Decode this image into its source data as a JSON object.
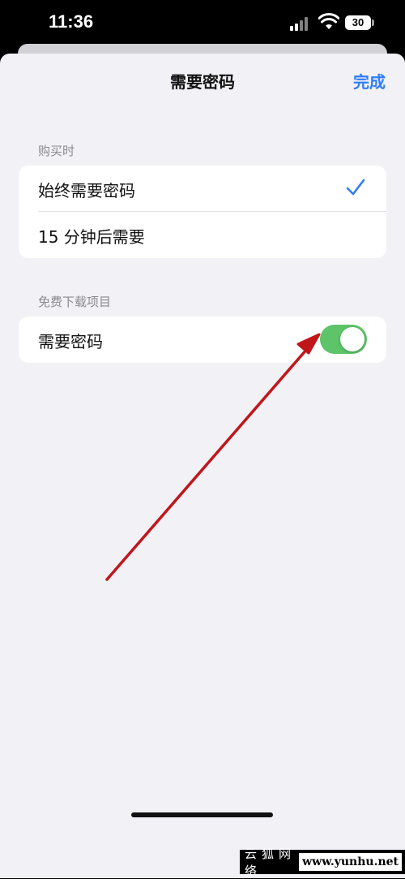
{
  "status_bar": {
    "time": "11:36",
    "battery": "30"
  },
  "nav": {
    "title": "需要密码",
    "done_label": "完成"
  },
  "sections": {
    "purchase": {
      "header": "购买时",
      "options": [
        {
          "label": "始终需要密码",
          "selected": true
        },
        {
          "label": "15 分钟后需要",
          "selected": false
        }
      ]
    },
    "free_downloads": {
      "header": "免费下载项目",
      "row_label": "需要密码",
      "toggle_on": true
    }
  },
  "watermark": {
    "name": "云狐网络",
    "url": "www.yunhu.net"
  },
  "colors": {
    "accent": "#2f7df6",
    "toggle_on": "#5dc46a",
    "annotation_arrow": "#c0161a",
    "background": "#f1f1f6"
  }
}
